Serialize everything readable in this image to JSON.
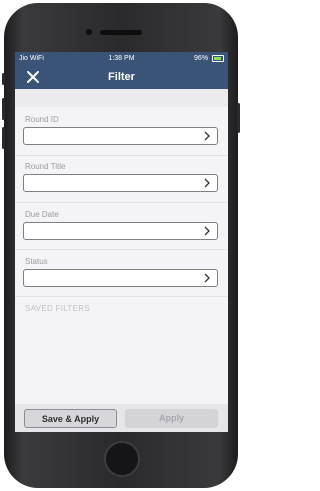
{
  "status_bar": {
    "carrier": "Jio WiFi",
    "time": "1:38 PM",
    "battery": "96%"
  },
  "nav": {
    "title": "Filter"
  },
  "fields": [
    {
      "label": "Round ID",
      "value": ""
    },
    {
      "label": "Round Title",
      "value": ""
    },
    {
      "label": "Due Date",
      "value": ""
    },
    {
      "label": "Status",
      "value": ""
    }
  ],
  "saved_filters_label": "SAVED FILTERS",
  "footer": {
    "save_apply_label": "Save & Apply",
    "apply_label": "Apply"
  },
  "colors": {
    "header": "#3a5478",
    "background": "#f4f4f6"
  }
}
